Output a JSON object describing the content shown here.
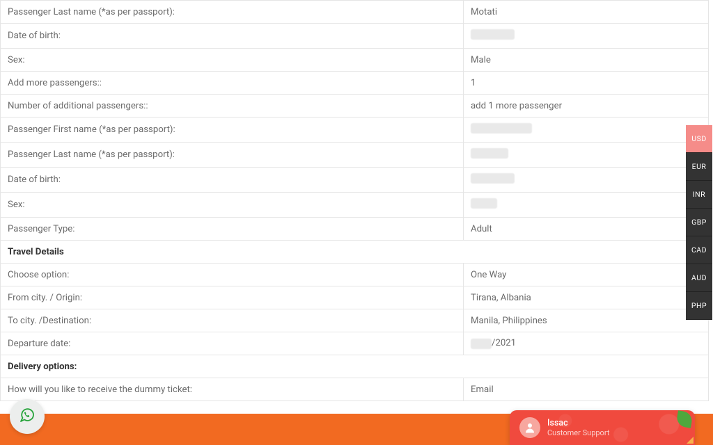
{
  "rows": [
    {
      "label": "Passenger Last name (*as per passport):",
      "value": "Motati"
    },
    {
      "label": "Date of birth:",
      "blurWidth": 63
    },
    {
      "label": "Sex:",
      "value": "Male"
    },
    {
      "label": "Add more passengers::",
      "value": "1"
    },
    {
      "label": "Number of additional passengers::",
      "value": "add 1 more passenger"
    },
    {
      "label": "Passenger First name (*as per passport):",
      "blurWidth": 88
    },
    {
      "label": "Passenger Last name (*as per passport):",
      "blurWidth": 54
    },
    {
      "label": "Date of birth:",
      "blurWidth": 63
    },
    {
      "label": "Sex:",
      "blurWidth": 38
    },
    {
      "label": "Passenger Type:",
      "value": "Adult"
    },
    {
      "section": "Travel Details"
    },
    {
      "label": "Choose option:",
      "value": "One Way"
    },
    {
      "label": "From city. / Origin:",
      "value": "Tirana, Albania"
    },
    {
      "label": "To city. /Destination:",
      "value": "Manila, Philippines"
    },
    {
      "label": "Departure date:",
      "valuePrefixBlur": 30,
      "valueSuffix": "/2021"
    },
    {
      "section": "Delivery options:"
    },
    {
      "label": "How will you like to receive the dummy ticket:",
      "value": "Email"
    }
  ],
  "currencies": [
    "USD",
    "EUR",
    "INR",
    "GBP",
    "CAD",
    "AUD",
    "PHP"
  ],
  "activeCurrency": "USD",
  "chat": {
    "name": "Issac",
    "role": "Customer Support"
  }
}
